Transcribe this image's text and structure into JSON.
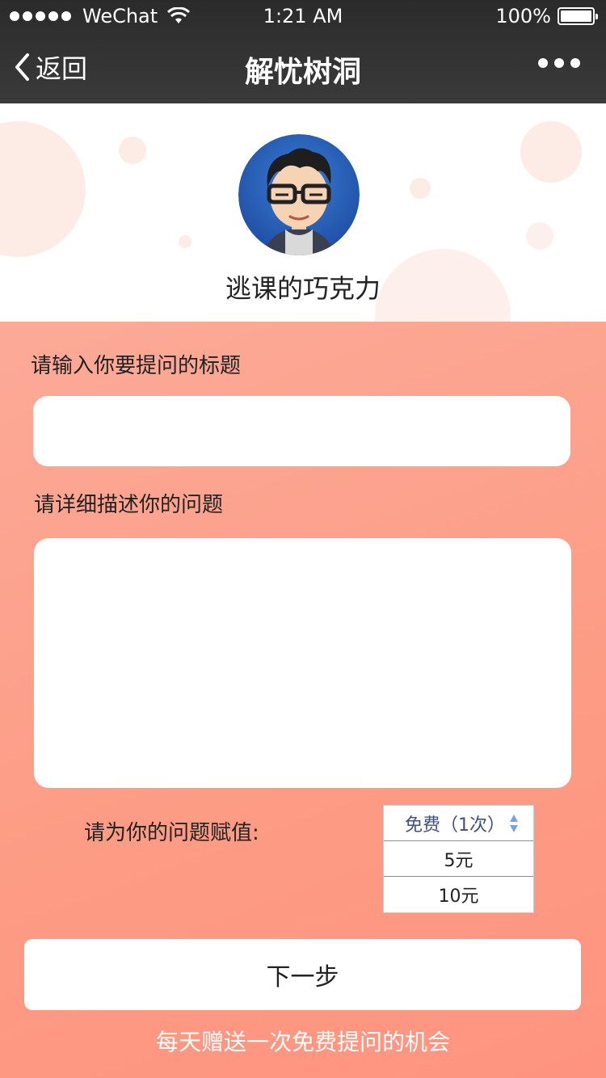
{
  "status_bar": {
    "carrier": "WeChat",
    "time": "1:21 AM",
    "battery": "100%"
  },
  "nav": {
    "back_label": "返回",
    "title": "解忧树洞"
  },
  "profile": {
    "username": "逃课的巧克力"
  },
  "form": {
    "title_label": "请输入你要提问的标题",
    "title_value": "",
    "desc_label": "请详细描述你的问题",
    "desc_value": "",
    "price_label": "请为你的问题赋值:",
    "price_options": [
      {
        "label": "免费（1次）",
        "selected": true
      },
      {
        "label": "5元",
        "selected": false
      },
      {
        "label": "10元",
        "selected": false
      }
    ],
    "next_label": "下一步",
    "footnote": "每天赠送一次免费提问的机会"
  },
  "colors": {
    "accent": "#fd9b84",
    "nav_bg": "#333333"
  }
}
